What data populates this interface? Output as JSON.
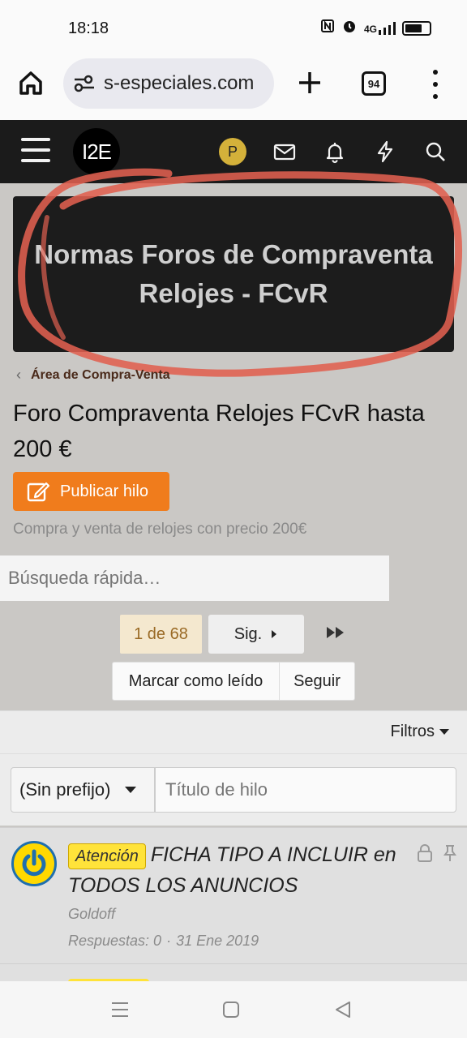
{
  "status_bar": {
    "time": "18:18",
    "network": "4G"
  },
  "browser": {
    "url": "s-especiales.com",
    "tab_count": "94"
  },
  "site_nav": {
    "logo": "I2E",
    "user_initial": "P"
  },
  "banner": {
    "text": "Normas Foros de Compraventa Relojes - FCvR"
  },
  "breadcrumb": {
    "label": "Área de Compra-Venta"
  },
  "forum": {
    "title": "Foro Compraventa Relojes FCvR hasta 200 €",
    "post_button": "Publicar hilo",
    "description": "Compra y venta de relojes con precio 200€"
  },
  "search": {
    "placeholder": "Búsqueda rápida…"
  },
  "pagination": {
    "current": "1 de 68",
    "next": "Sig."
  },
  "actions": {
    "mark_read": "Marcar como leído",
    "follow": "Seguir"
  },
  "filters": {
    "label": "Filtros"
  },
  "new_thread": {
    "prefix": "(Sin prefijo)",
    "title_placeholder": "Título de hilo"
  },
  "threads": [
    {
      "badge": "Atención",
      "title": "FICHA TIPO A INCLUIR en TODOS LOS ANUNCIOS",
      "author": "Goldoff",
      "replies": "Respuestas: 0",
      "date": "31 Ene 2019"
    }
  ],
  "colors": {
    "accent": "#f07c1c",
    "badge": "#ffe33a",
    "highlight": "#e06050"
  }
}
